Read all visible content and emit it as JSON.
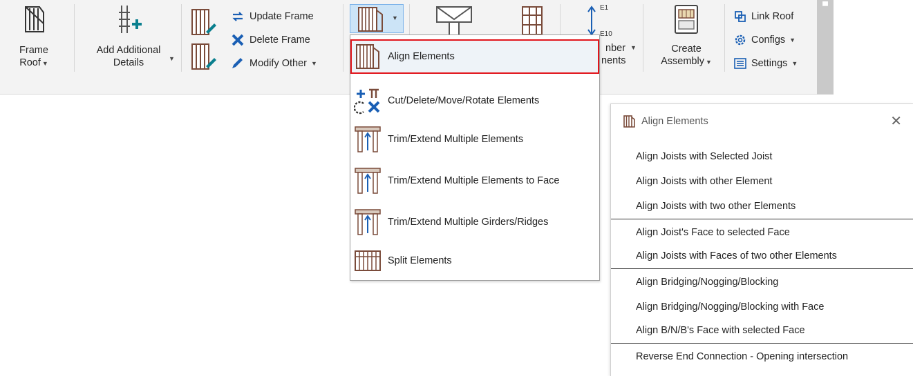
{
  "ribbon": {
    "frame_roof": {
      "line1": "Frame",
      "line2": "Roof"
    },
    "add_details": {
      "line1": "Add Additional",
      "line2": "Details"
    },
    "update_frame": "Update Frame",
    "delete_frame": "Delete Frame",
    "modify_other": "Modify Other",
    "member_elements": {
      "line1": "nber",
      "line2": "nents"
    },
    "create_assembly": {
      "line1": "Create",
      "line2": "Assembly"
    },
    "link_roof": "Link Roof",
    "configs": "Configs",
    "settings": "Settings",
    "e1_label": "E1",
    "e10_label": "E10"
  },
  "menu": {
    "items": [
      {
        "label": "Align Elements",
        "icon": "align-elements-icon"
      },
      {
        "label": "Cut/Delete/Move/Rotate Elements",
        "icon": "cut-move-rotate-icon"
      },
      {
        "label": "Trim/Extend Multiple Elements",
        "icon": "trim-extend-icon"
      },
      {
        "label": "Trim/Extend Multiple Elements to Face",
        "icon": "trim-extend-face-icon"
      },
      {
        "label": "Trim/Extend Multiple Girders/Ridges",
        "icon": "trim-extend-girders-icon"
      },
      {
        "label": "Split Elements",
        "icon": "split-elements-icon"
      }
    ]
  },
  "panel": {
    "title": "Align Elements",
    "close": "✕",
    "items": [
      "Align Joists with Selected Joist",
      "Align Joists with other Element",
      "Align Joists with two other Elements",
      "Align Joist's Face to selected Face",
      "Align Joists with Faces of two other Elements",
      "Align Bridging/Nogging/Blocking",
      "Align Bridging/Nogging/Blocking with Face",
      "Align B/N/B's Face with selected Face",
      "Reverse End Connection - Opening intersection"
    ]
  },
  "colors": {
    "accent_teal": "#0a7f8e",
    "accent_blue": "#1a5fb4",
    "highlight_red": "#e2141b",
    "frame_brown": "#7a4b3a"
  }
}
